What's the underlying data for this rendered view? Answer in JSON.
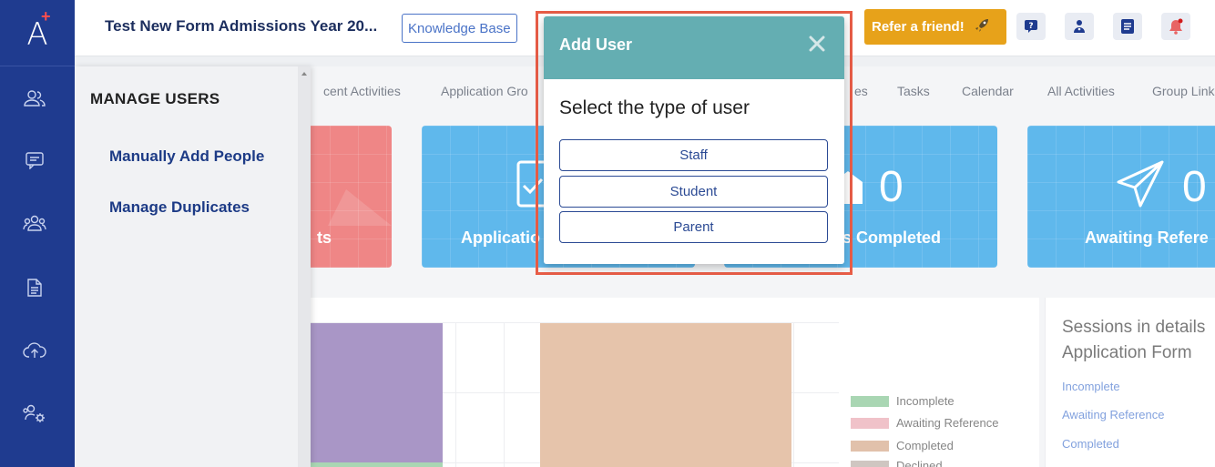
{
  "app": {
    "logo_letter": "A",
    "logo_plus": "+"
  },
  "rail": {
    "items": [
      {
        "icon": "users-icon"
      },
      {
        "icon": "chat-icon"
      },
      {
        "icon": "group-icon"
      },
      {
        "icon": "document-icon"
      },
      {
        "icon": "cloud-upload-icon"
      },
      {
        "icon": "users-settings-icon"
      }
    ]
  },
  "header": {
    "title": "Test New Form Admissions Year 20...",
    "knowledge_base": "Knowledge Base",
    "refer": "Refer a friend!",
    "icons": [
      "help-icon",
      "support-icon",
      "notes-icon",
      "notification-bell-icon"
    ]
  },
  "tabs": [
    "cent Activities",
    "Application Gro",
    "es",
    "Tasks",
    "Calendar",
    "All Activities",
    "Group Link"
  ],
  "cards": [
    {
      "label": "ts",
      "value": ""
    },
    {
      "label": "Applicatio",
      "value": ""
    },
    {
      "label": "es Completed",
      "value": "0"
    },
    {
      "label": "Awaiting Refere",
      "value": "0"
    }
  ],
  "legend": {
    "items": [
      {
        "label": "Incomplete",
        "color": "#7cc08a"
      },
      {
        "label": "Awaiting Reference",
        "color": "#e9a2ad"
      },
      {
        "label": "Completed",
        "color": "#d2a07f"
      },
      {
        "label": "Declined",
        "color": "#b5a8a0"
      }
    ]
  },
  "sessions": {
    "title_line1": "Sessions in details",
    "title_line2": "Application Form",
    "links": [
      "Incomplete",
      "Awaiting Reference",
      "Completed"
    ]
  },
  "drawer": {
    "title": "MANAGE USERS",
    "items": [
      "Manually Add People",
      "Manage Duplicates"
    ]
  },
  "modal": {
    "title": "Add User",
    "prompt": "Select the type of user",
    "options": [
      "Staff",
      "Student",
      "Parent"
    ]
  },
  "colors": {
    "rail": "#1f3b8f",
    "card_blue": "#0a92e2",
    "card_red": "#e64545",
    "modal_header": "#64aeb2",
    "refer_button": "#e7a21a",
    "highlight": "#e85d47"
  }
}
